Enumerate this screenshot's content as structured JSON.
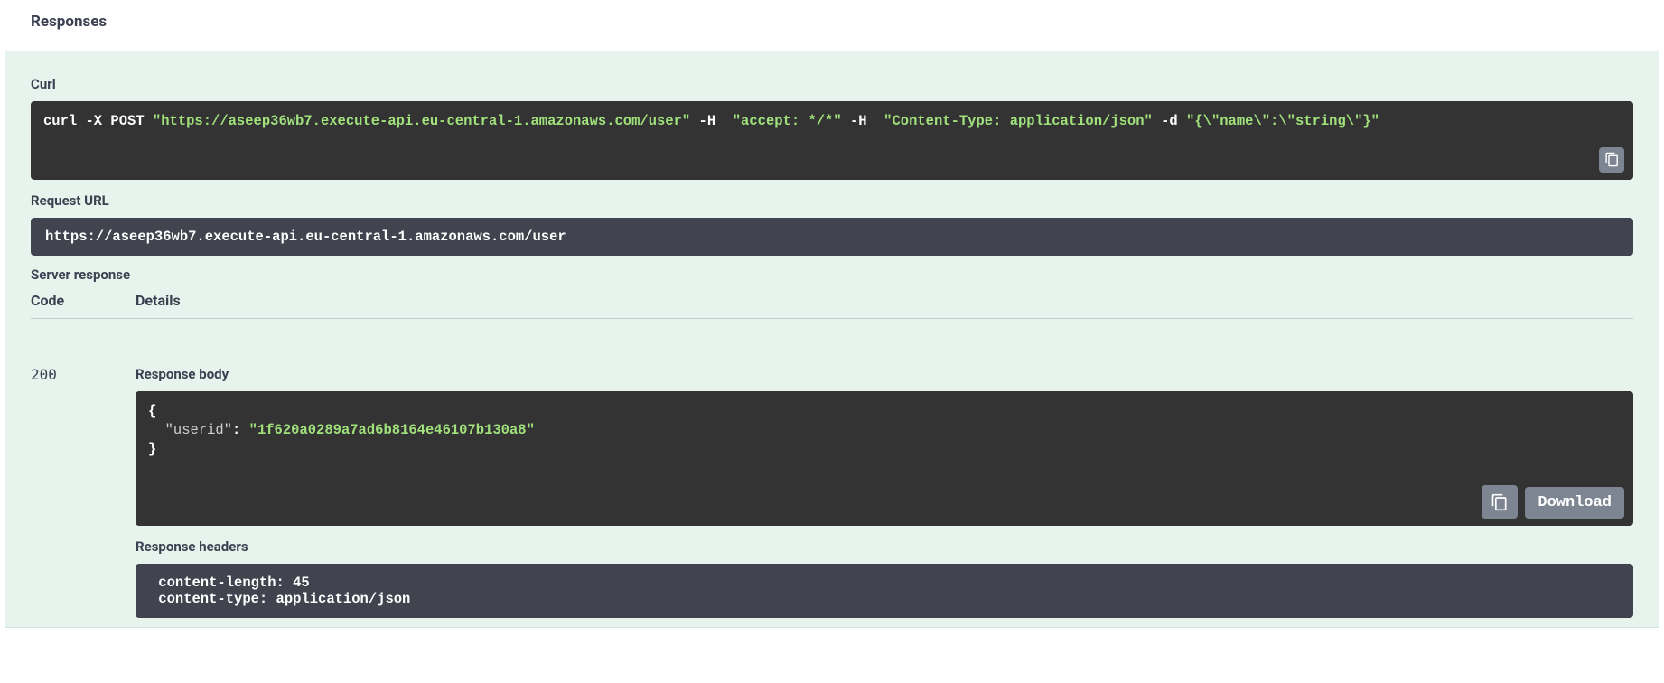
{
  "header": {
    "title": "Responses"
  },
  "curl": {
    "label": "Curl",
    "parts": {
      "cmd": "curl -X POST ",
      "url": "\"https://aseep36wb7.execute-api.eu-central-1.amazonaws.com/user\"",
      "h1flag": " -H  ",
      "h1val": "\"accept: */*\"",
      "h2flag": " -H  ",
      "h2val": "\"Content-Type: application/json\"",
      "dflag": " -d ",
      "dval": "\"{\\\"name\\\":\\\"string\\\"}\""
    }
  },
  "request_url": {
    "label": "Request URL",
    "value": "https://aseep36wb7.execute-api.eu-central-1.amazonaws.com/user"
  },
  "server_response": {
    "label": "Server response",
    "code_header": "Code",
    "details_header": "Details",
    "status_code": "200",
    "response_body": {
      "label": "Response body",
      "open_brace": "{",
      "key_line_prefix": "  ",
      "key": "\"userid\"",
      "colon": ": ",
      "value": "\"1f620a0289a7ad6b8164e46107b130a8\"",
      "close_brace": "}"
    },
    "download_label": "Download",
    "response_headers": {
      "label": "Response headers",
      "line1": " content-length: 45 ",
      "line2": " content-type: application/json "
    }
  }
}
